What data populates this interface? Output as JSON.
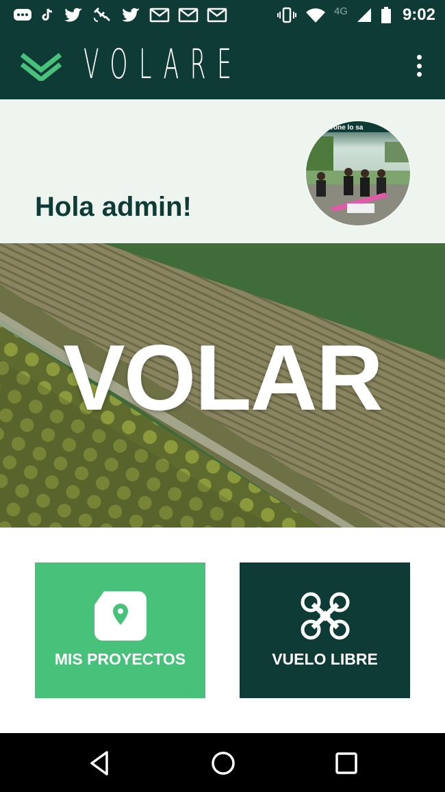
{
  "status_bar": {
    "time": "9:02",
    "network": "4G",
    "left_icons": [
      "chat-bubble-icon",
      "tiktok-icon",
      "twitter-icon",
      "satellite-icon",
      "twitter-icon",
      "gmail-icon",
      "gmail-icon",
      "gmail-icon"
    ],
    "right_icons": [
      "vibrate-icon",
      "wifi-icon",
      "signal-icon",
      "battery-icon"
    ]
  },
  "app_bar": {
    "brand": "VOLARE",
    "menu_icon": "more-vert-icon"
  },
  "greeting": {
    "text": "Hola admin!",
    "avatar_caption": "drone lo sa"
  },
  "hero": {
    "title": "VOLAR"
  },
  "actions": [
    {
      "label": "MIS PROYECTOS",
      "icon": "folder-location-icon",
      "color": "#48c17a"
    },
    {
      "label": "VUELO LIBRE",
      "icon": "drone-icon",
      "color": "#0f3b37"
    }
  ],
  "nav_bar": {
    "buttons": [
      "back-icon",
      "home-icon",
      "recents-icon"
    ]
  },
  "colors": {
    "primary_dark": "#0f3b37",
    "accent_green": "#48c17a",
    "greeting_bg": "#eef5ee"
  }
}
